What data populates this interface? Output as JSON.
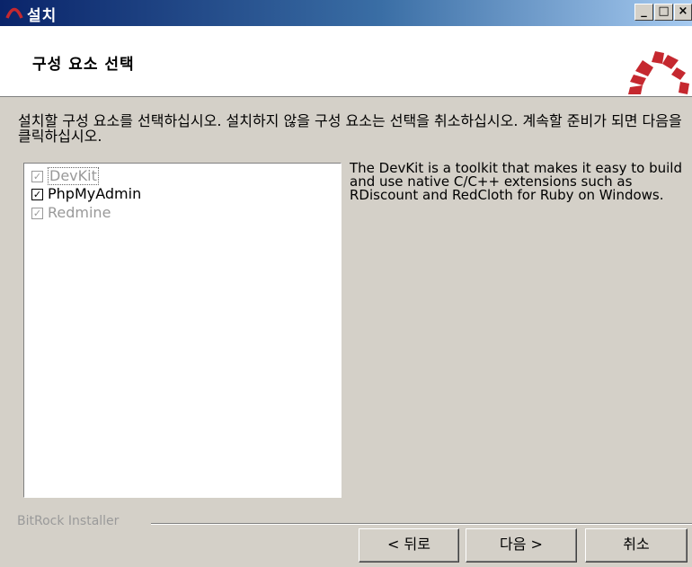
{
  "window": {
    "title": "설치",
    "controls": {
      "minimize": "_",
      "maximize": "□",
      "close": "×"
    }
  },
  "header": {
    "title": "구성 요소 선택",
    "logo_icon": "bitnami-arch-icon",
    "logo_colors": [
      "#c5282f",
      "#7a1a1e"
    ]
  },
  "instruction": "설치할 구성 요소를 선택하십시오. 설치하지 않을 구성 요소는 선택을 취소하십시오. 계속할 준비가 되면 다음을 클릭하십시오.",
  "components": [
    {
      "label": "DevKit",
      "checked": true,
      "enabled": false,
      "focused": true
    },
    {
      "label": "PhpMyAdmin",
      "checked": true,
      "enabled": true,
      "focused": false
    },
    {
      "label": "Redmine",
      "checked": true,
      "enabled": false,
      "focused": false
    }
  ],
  "description": "The DevKit is a toolkit that makes it easy to build and use native C/C++ extensions such as RDiscount and RedCloth for Ruby on Windows.",
  "footer": {
    "installer_label": "BitRock Installer",
    "back_button": "< 뒤로",
    "next_button": "다음 >",
    "cancel_button": "취소"
  }
}
